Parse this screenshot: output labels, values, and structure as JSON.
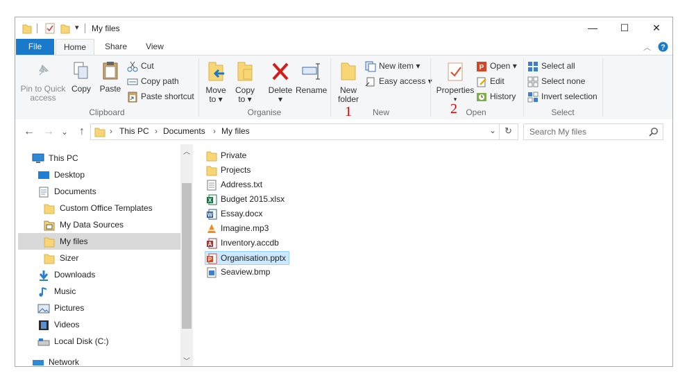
{
  "window": {
    "title": "My files",
    "minimize_glyph": "—",
    "maximize_glyph": "☐",
    "close_glyph": "✕"
  },
  "tabs": {
    "file": "File",
    "home": "Home",
    "share": "Share",
    "view": "View"
  },
  "ribbon": {
    "clipboard": {
      "label": "Clipboard",
      "pin_line1": "Pin to Quick",
      "pin_line2": "access",
      "copy": "Copy",
      "paste": "Paste",
      "cut": "Cut",
      "copy_path": "Copy path",
      "paste_shortcut": "Paste shortcut"
    },
    "organise": {
      "label": "Organise",
      "move_to_l1": "Move",
      "move_to_l2": "to ▾",
      "copy_to_l1": "Copy",
      "copy_to_l2": "to ▾",
      "delete": "Delete ▾",
      "rename": "Rename"
    },
    "new": {
      "label": "New",
      "new_folder_l1": "New",
      "new_folder_l2": "folder",
      "new_item": "New item ▾",
      "easy_access": "Easy access ▾",
      "marker": "1"
    },
    "open": {
      "label": "Open",
      "properties": "Properties",
      "properties_arrow": "▾",
      "open": "Open ▾",
      "edit": "Edit",
      "history": "History",
      "marker": "2"
    },
    "select": {
      "label": "Select",
      "select_all": "Select all",
      "select_none": "Select none",
      "invert_selection": "Invert selection"
    }
  },
  "address": {
    "back": "←",
    "forward": "→",
    "recent": "⌄",
    "up": "↑",
    "crumbs": [
      "This PC",
      "Documents",
      "My files"
    ],
    "separator": "›",
    "search_placeholder": "Search My files"
  },
  "nav": {
    "items": [
      {
        "label": "This PC",
        "icon": "pc-icon"
      },
      {
        "label": "Desktop",
        "icon": "desktop-icon"
      },
      {
        "label": "Documents",
        "icon": "documents-icon"
      },
      {
        "label": "Custom Office Templates",
        "icon": "folder-icon"
      },
      {
        "label": "My Data Sources",
        "icon": "data-sources-icon"
      },
      {
        "label": "My files",
        "icon": "folder-icon"
      },
      {
        "label": "Sizer",
        "icon": "folder-icon"
      },
      {
        "label": "Downloads",
        "icon": "downloads-icon"
      },
      {
        "label": "Music",
        "icon": "music-icon"
      },
      {
        "label": "Pictures",
        "icon": "pictures-icon"
      },
      {
        "label": "Videos",
        "icon": "videos-icon"
      },
      {
        "label": "Local Disk (C:)",
        "icon": "disk-icon"
      },
      {
        "label": "Network",
        "icon": "network-icon"
      }
    ]
  },
  "files": [
    {
      "name": "Private",
      "icon": "folder-icon"
    },
    {
      "name": "Projects",
      "icon": "folder-icon"
    },
    {
      "name": "Address.txt",
      "icon": "text-file-icon"
    },
    {
      "name": "Budget 2015.xlsx",
      "icon": "excel-file-icon"
    },
    {
      "name": "Essay.docx",
      "icon": "word-file-icon"
    },
    {
      "name": "Imagine.mp3",
      "icon": "vlc-file-icon"
    },
    {
      "name": "Inventory.accdb",
      "icon": "access-file-icon"
    },
    {
      "name": "Organisation.pptx",
      "icon": "powerpoint-file-icon"
    },
    {
      "name": "Seaview.bmp",
      "icon": "bitmap-file-icon"
    }
  ],
  "colors": {
    "accent": "#1979ca",
    "folder": "#f8d675",
    "selection": "#cce8ff",
    "marker": "#d40000"
  }
}
